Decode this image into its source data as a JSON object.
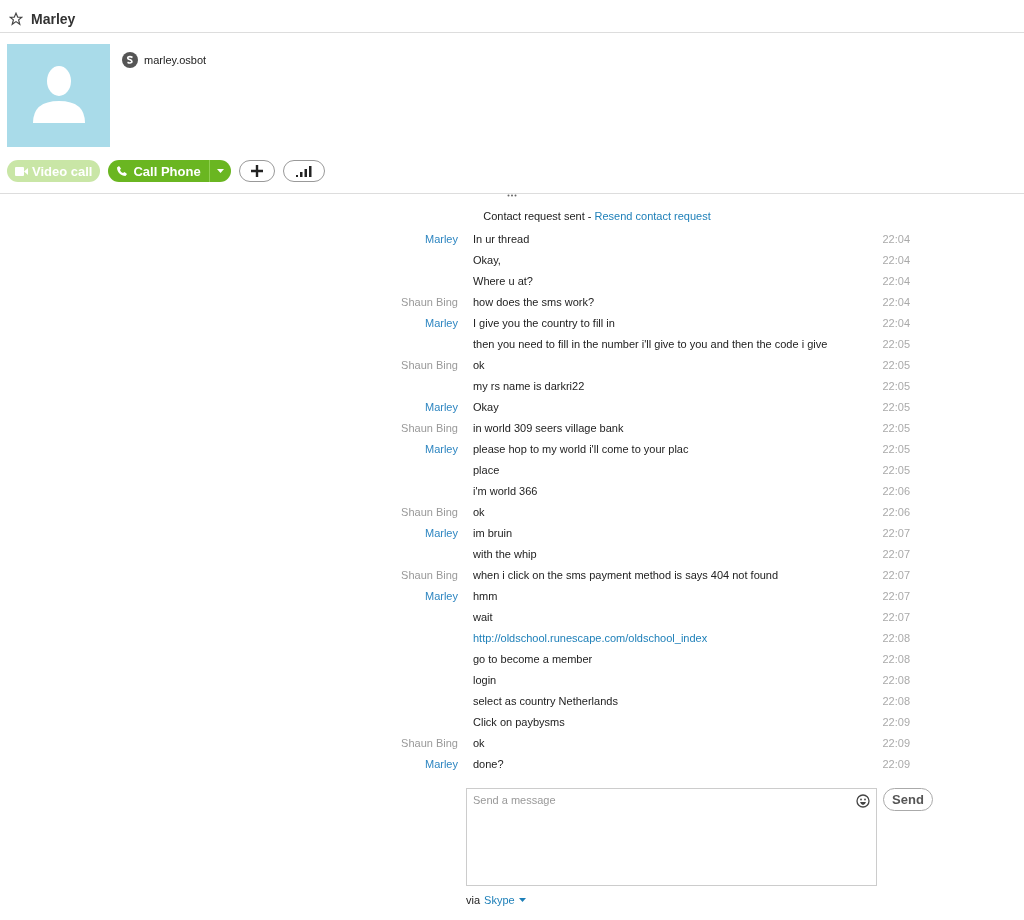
{
  "contact": {
    "name": "Marley",
    "username": "marley.osbot",
    "favorite": false
  },
  "actions": {
    "video_call": {
      "label": "Video call",
      "disabled": true
    },
    "call_phone": {
      "label": "Call Phone",
      "disabled": false
    }
  },
  "notice": {
    "text": "Contact request sent -",
    "link": "Resend contact request"
  },
  "messages": [
    {
      "sender": "Marley",
      "color": "#2e86c1",
      "text": "In ur thread",
      "time": "22:04",
      "kind": "text"
    },
    {
      "text": "Okay,",
      "time": "22:04",
      "kind": "text"
    },
    {
      "text": "Where u at?",
      "time": "22:04",
      "kind": "text"
    },
    {
      "sender": "Shaun Bing",
      "color": "#999999",
      "text": "how does the sms work?",
      "time": "22:04",
      "kind": "text"
    },
    {
      "sender": "Marley",
      "color": "#2e86c1",
      "text": "I give you the country to fill in",
      "time": "22:04",
      "kind": "text"
    },
    {
      "text": "then you need to fill in the number i'll give to you and then the code i give",
      "time": "22:05",
      "kind": "text"
    },
    {
      "sender": "Shaun Bing",
      "color": "#999999",
      "text": "ok",
      "time": "22:05",
      "kind": "text"
    },
    {
      "text": "my rs name is darkri22",
      "time": "22:05",
      "kind": "text"
    },
    {
      "sender": "Marley",
      "color": "#2e86c1",
      "text": "Okay",
      "time": "22:05",
      "kind": "text"
    },
    {
      "sender": "Shaun Bing",
      "color": "#999999",
      "text": "in world 309 seers village bank",
      "time": "22:05",
      "kind": "text"
    },
    {
      "sender": "Marley",
      "color": "#2e86c1",
      "text": "please hop to my world i'll come to your plac",
      "time": "22:05",
      "kind": "text"
    },
    {
      "text": "place",
      "time": "22:05",
      "kind": "text"
    },
    {
      "text": "i'm world 366",
      "time": "22:06",
      "kind": "text"
    },
    {
      "sender": "Shaun Bing",
      "color": "#999999",
      "text": "ok",
      "time": "22:06",
      "kind": "text"
    },
    {
      "sender": "Marley",
      "color": "#2e86c1",
      "text": "im bruin",
      "time": "22:07",
      "kind": "text"
    },
    {
      "text": "with the whip",
      "time": "22:07",
      "kind": "text"
    },
    {
      "sender": "Shaun Bing",
      "color": "#999999",
      "text": "when i click on the sms payment method is says 404 not found",
      "time": "22:07",
      "kind": "text"
    },
    {
      "sender": "Marley",
      "color": "#2e86c1",
      "text": "hmm",
      "time": "22:07",
      "kind": "text"
    },
    {
      "text": "wait",
      "time": "22:07",
      "kind": "text"
    },
    {
      "text": "http://oldschool.runescape.com/oldschool_index",
      "time": "22:08",
      "kind": "link"
    },
    {
      "text": "go to become a member",
      "time": "22:08",
      "kind": "text"
    },
    {
      "text": "login",
      "time": "22:08",
      "kind": "text"
    },
    {
      "text": "select as country Netherlands",
      "time": "22:08",
      "kind": "text"
    },
    {
      "text": "Click on paybysms",
      "time": "22:09",
      "kind": "text"
    },
    {
      "sender": "Shaun Bing",
      "color": "#999999",
      "text": "ok",
      "time": "22:09",
      "kind": "text"
    },
    {
      "sender": "Marley",
      "color": "#2e86c1",
      "text": "done?",
      "time": "22:09",
      "kind": "text"
    }
  ],
  "composer": {
    "placeholder": "Send a message",
    "send": "Send",
    "via": "via",
    "service": "Skype"
  }
}
